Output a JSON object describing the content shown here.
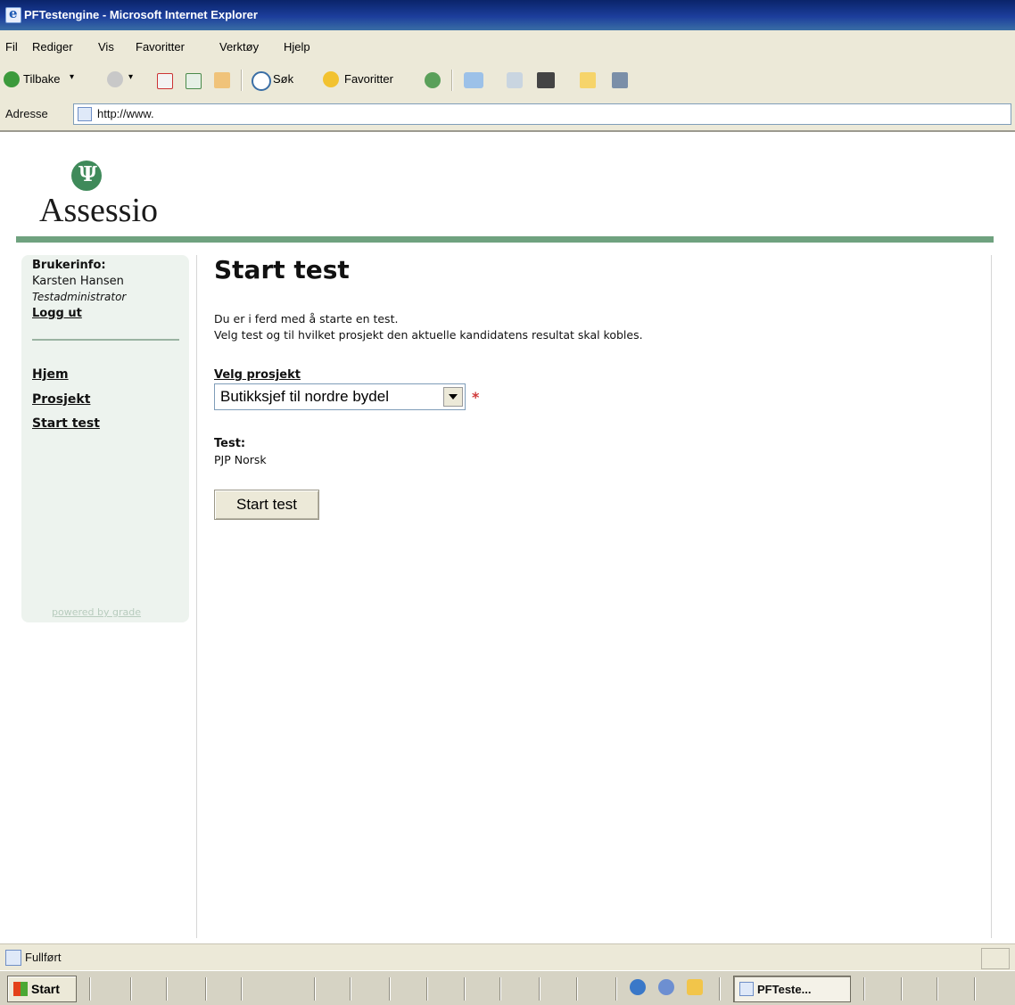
{
  "window": {
    "title": "PFTestengine - Microsoft Internet Explorer"
  },
  "menu": [
    "Fil",
    "Rediger",
    "Vis",
    "Favoritter",
    "Verktøy",
    "Hjelp"
  ],
  "toolbar": {
    "back": "Tilbake",
    "search": "Søk",
    "favorites": "Favoritter"
  },
  "address": {
    "label": "Adresse",
    "url": "http://www."
  },
  "logo": {
    "symbol": "Ψ",
    "text": "Assessio"
  },
  "sidebar": {
    "userinfo_label": "Brukerinfo:",
    "user_name": "Karsten Hansen",
    "user_role": "Testadministrator",
    "logout": "Logg ut",
    "nav": [
      "Hjem",
      "Prosjekt",
      "Start test"
    ],
    "powered": "powered by grade"
  },
  "main": {
    "heading": "Start test",
    "intro_line1": "Du er i ferd med å starte en test.",
    "intro_line2": "Velg test og til hvilket prosjekt den aktuelle kandidatens resultat skal kobles.",
    "project_label": "Velg prosjekt",
    "project_value": "Butikksjef til nordre bydel",
    "required_mark": "*",
    "test_label": "Test:",
    "test_value": "PJP Norsk",
    "start_button": "Start test"
  },
  "status": {
    "text": "Fullført"
  },
  "taskbar": {
    "start": "Start",
    "window": "PFTeste..."
  },
  "colors": {
    "accent_green": "#6fa27f",
    "sidebar_bg": "#edf3ee",
    "titlebar": "#0a246a"
  }
}
